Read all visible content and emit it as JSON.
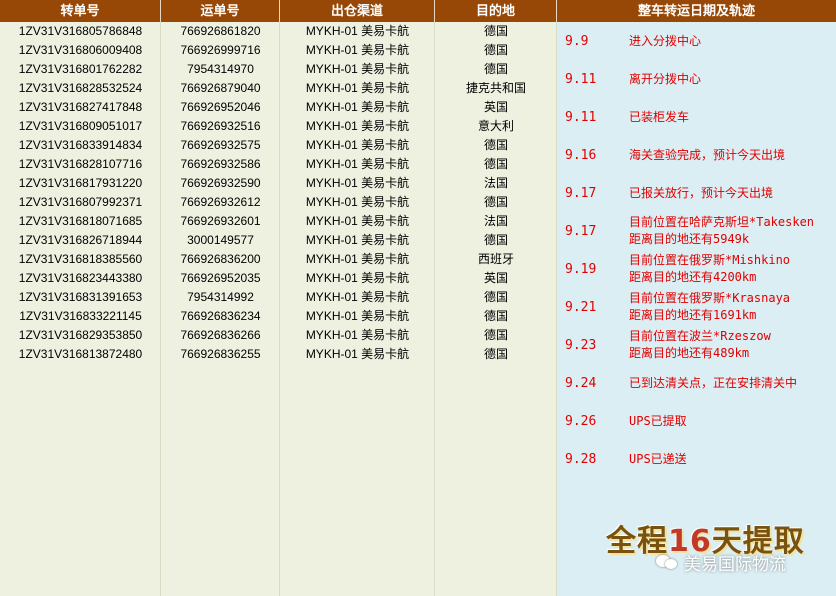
{
  "headers": {
    "transfer_no": "转单号",
    "waybill_no": "运单号",
    "channel": "出仓渠道",
    "destination": "目的地",
    "tracking": "整车转运日期及轨迹"
  },
  "rows": [
    {
      "transfer": "1ZV31V316805786848",
      "waybill": "766926861820",
      "channel": "MYKH-01 美易卡航",
      "dest": "德国"
    },
    {
      "transfer": "1ZV31V316806009408",
      "waybill": "766926999716",
      "channel": "MYKH-01 美易卡航",
      "dest": "德国"
    },
    {
      "transfer": "1ZV31V316801762282",
      "waybill": "7954314970",
      "channel": "MYKH-01 美易卡航",
      "dest": "德国"
    },
    {
      "transfer": "1ZV31V316828532524",
      "waybill": "766926879040",
      "channel": "MYKH-01 美易卡航",
      "dest": "捷克共和国"
    },
    {
      "transfer": "1ZV31V316827417848",
      "waybill": "766926952046",
      "channel": "MYKH-01 美易卡航",
      "dest": "英国"
    },
    {
      "transfer": "1ZV31V316809051017",
      "waybill": "766926932516",
      "channel": "MYKH-01 美易卡航",
      "dest": "意大利"
    },
    {
      "transfer": "1ZV31V316833914834",
      "waybill": "766926932575",
      "channel": "MYKH-01 美易卡航",
      "dest": "德国"
    },
    {
      "transfer": "1ZV31V316828107716",
      "waybill": "766926932586",
      "channel": "MYKH-01 美易卡航",
      "dest": "德国"
    },
    {
      "transfer": "1ZV31V316817931220",
      "waybill": "766926932590",
      "channel": "MYKH-01 美易卡航",
      "dest": "法国"
    },
    {
      "transfer": "1ZV31V316807992371",
      "waybill": "766926932612",
      "channel": "MYKH-01 美易卡航",
      "dest": "德国"
    },
    {
      "transfer": "1ZV31V316818071685",
      "waybill": "766926932601",
      "channel": "MYKH-01 美易卡航",
      "dest": "法国"
    },
    {
      "transfer": "1ZV31V316826718944",
      "waybill": "3000149577",
      "channel": "MYKH-01 美易卡航",
      "dest": "德国"
    },
    {
      "transfer": "1ZV31V316818385560",
      "waybill": "766926836200",
      "channel": "MYKH-01 美易卡航",
      "dest": "西班牙"
    },
    {
      "transfer": "1ZV31V316823443380",
      "waybill": "766926952035",
      "channel": "MYKH-01 美易卡航",
      "dest": "英国"
    },
    {
      "transfer": "1ZV31V316831391653",
      "waybill": "7954314992",
      "channel": "MYKH-01 美易卡航",
      "dest": "德国"
    },
    {
      "transfer": "1ZV31V316833221145",
      "waybill": "766926836234",
      "channel": "MYKH-01 美易卡航",
      "dest": "德国"
    },
    {
      "transfer": "1ZV31V316829353850",
      "waybill": "766926836266",
      "channel": "MYKH-01 美易卡航",
      "dest": "德国"
    },
    {
      "transfer": "1ZV31V316813872480",
      "waybill": "766926836255",
      "channel": "MYKH-01 美易卡航",
      "dest": "德国"
    }
  ],
  "tracking": [
    {
      "date": "9.9",
      "lines": [
        "进入分拨中心"
      ]
    },
    {
      "date": "9.11",
      "lines": [
        "离开分拨中心"
      ]
    },
    {
      "date": "9.11",
      "lines": [
        "已装柜发车"
      ]
    },
    {
      "date": "9.16",
      "lines": [
        "海关查验完成，预计今天出境"
      ]
    },
    {
      "date": "9.17",
      "lines": [
        "已报关放行，预计今天出境"
      ]
    },
    {
      "date": "9.17",
      "lines": [
        "目前位置在哈萨克斯坦*Takesken",
        "距离目的地还有5949k"
      ]
    },
    {
      "date": "9.19",
      "lines": [
        "目前位置在俄罗斯*Mishkino",
        "距离目的地还有4200km"
      ]
    },
    {
      "date": "9.21",
      "lines": [
        "目前位置在俄罗斯*Krasnaya",
        "距离目的地还有1691km"
      ]
    },
    {
      "date": "9.23",
      "lines": [
        "目前位置在波兰*Rzeszow",
        "距离目的地还有489km"
      ]
    },
    {
      "date": "9.24",
      "lines": [
        "已到达清关点，正在安排清关中"
      ]
    },
    {
      "date": "9.26",
      "lines": [
        "UPS已提取"
      ]
    },
    {
      "date": "9.28",
      "lines": [
        "UPS已递送"
      ]
    }
  ],
  "promo": {
    "prefix": "全程",
    "number": "16",
    "suffix": "天提取"
  },
  "watermark": {
    "text": "美易国际物流",
    "icon": "wechat-icon"
  },
  "colors": {
    "header_bg": "#974706",
    "table_bg": "#eef0e0",
    "tracking_bg": "#dbeef4",
    "tracking_text": "#e00000"
  }
}
